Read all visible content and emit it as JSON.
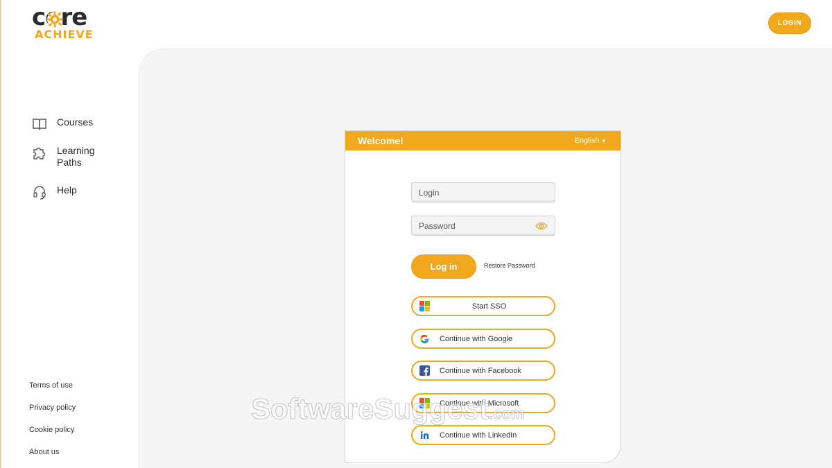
{
  "brand": {
    "logo_top": "core",
    "logo_bottom": "ACHIEVE",
    "accent_color": "#f2a81d"
  },
  "header": {
    "login_button": "LOGIN"
  },
  "sidebar": {
    "items": [
      {
        "label": "Courses",
        "icon": "book-icon"
      },
      {
        "label": "Learning Paths",
        "icon": "puzzle-icon"
      },
      {
        "label": "Help",
        "icon": "headset-icon"
      }
    ],
    "footer_links": [
      "Terms of use",
      "Privacy policy",
      "Cookie policy",
      "About us"
    ]
  },
  "login_card": {
    "title": "Welcome!",
    "language": "English",
    "login_placeholder": "Login",
    "password_placeholder": "Password",
    "login_button": "Log in",
    "restore_link": "Restore Password",
    "sso_buttons": [
      {
        "label": "Start SSO",
        "icon": "windows-icon"
      },
      {
        "label": "Continue with Google",
        "icon": "google-icon"
      },
      {
        "label": "Continue with Facebook",
        "icon": "facebook-icon"
      },
      {
        "label": "Continue with Microsoft",
        "icon": "microsoft-icon"
      },
      {
        "label": "Continue with LinkedIn",
        "icon": "linkedin-icon"
      }
    ]
  },
  "watermark": {
    "text": "SoftwareSuggest",
    "suffix": ".com"
  }
}
